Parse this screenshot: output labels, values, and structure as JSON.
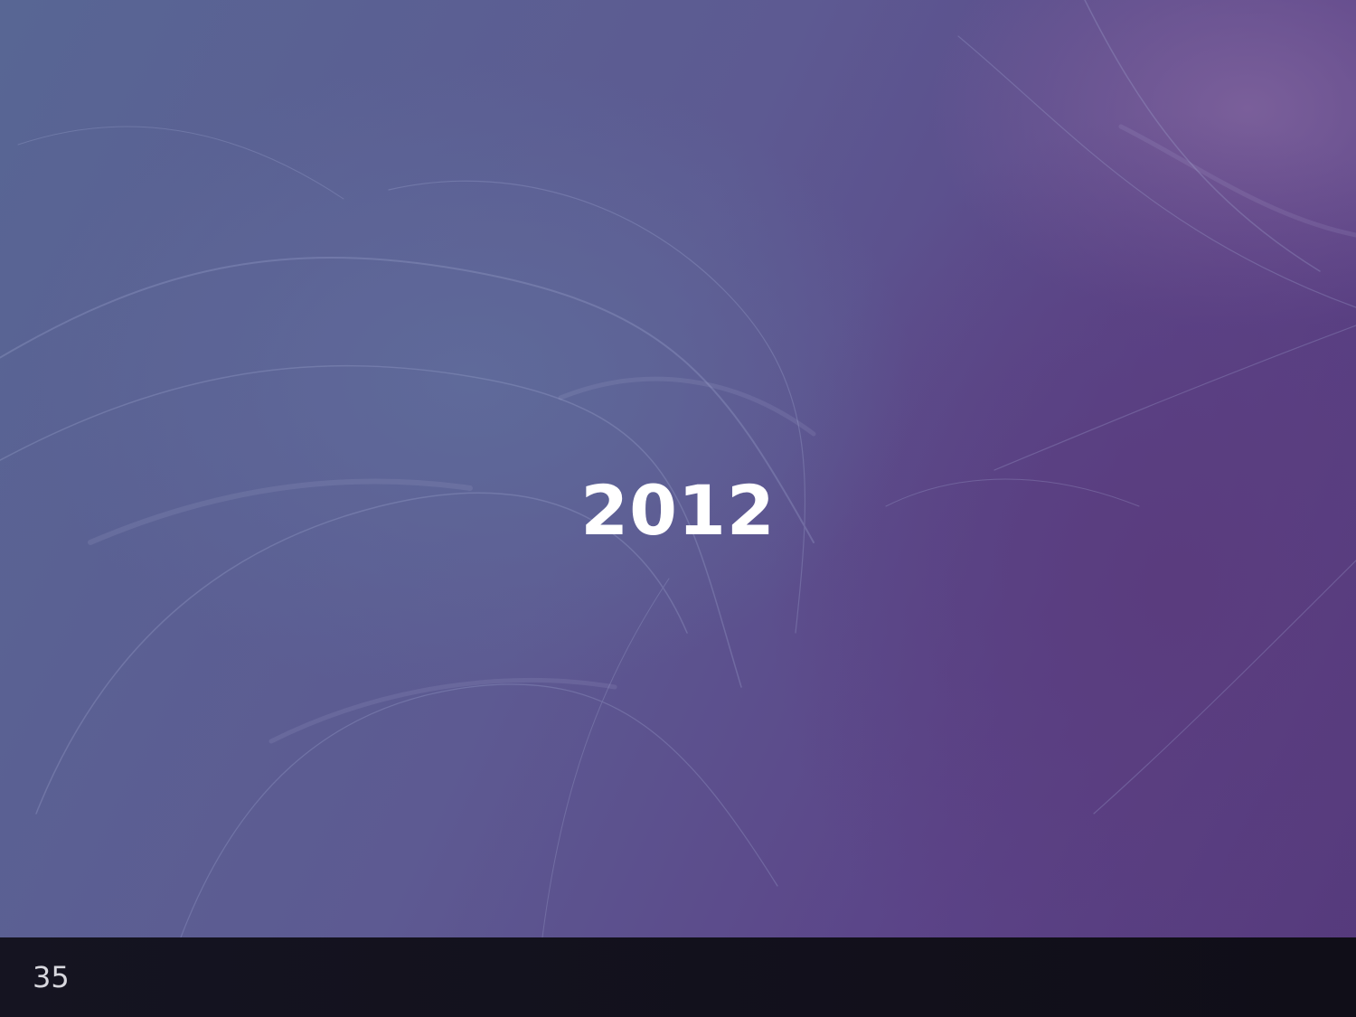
{
  "slide": {
    "title": "2012",
    "background_image": "purple-feathers-photo",
    "accent_color": "#5b4488"
  },
  "footer": {
    "page_number": "35"
  }
}
